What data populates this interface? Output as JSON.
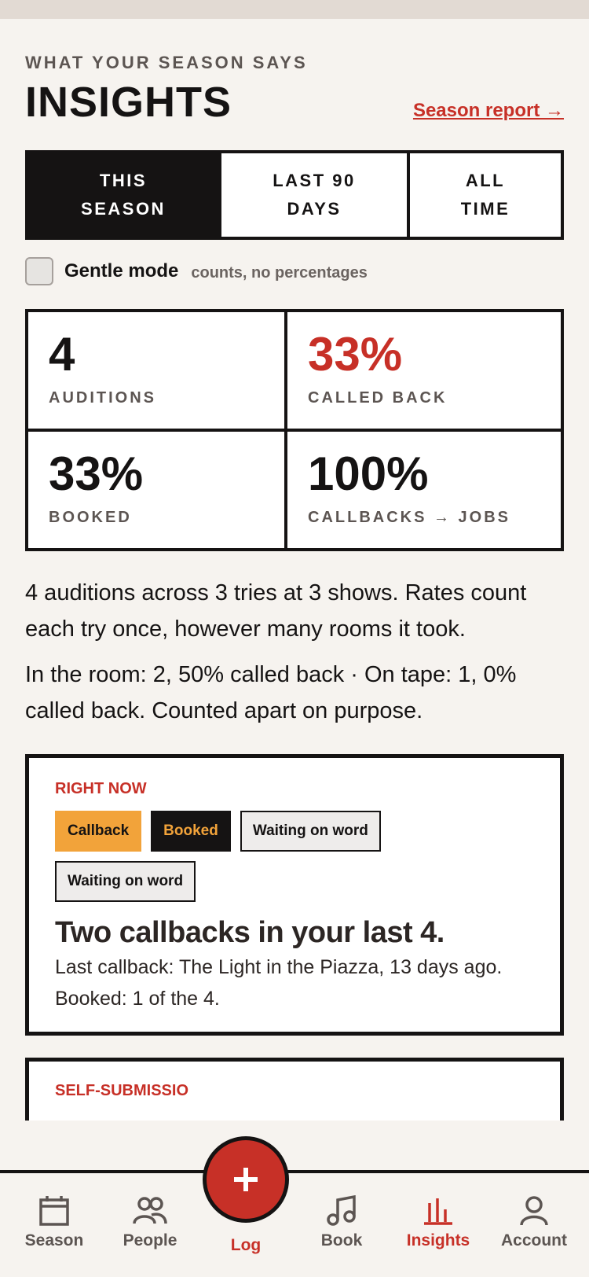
{
  "header": {
    "eyebrow": "WHAT YOUR SEASON SAYS",
    "title": "INSIGHTS",
    "report_link": "Season report →"
  },
  "tabs": [
    {
      "label": "THIS\nSEASON",
      "selected": true
    },
    {
      "label": "LAST 90\nDAYS",
      "selected": false
    },
    {
      "label": "ALL\nTIME",
      "selected": false
    }
  ],
  "gentle_mode": {
    "label": "Gentle mode",
    "hint": "counts, no percentages",
    "checked": false
  },
  "stats": [
    {
      "value": "4",
      "label": "AUDITIONS"
    },
    {
      "value": "33%",
      "label": "CALLED BACK"
    },
    {
      "value": "33%",
      "label": "BOOKED"
    },
    {
      "value": "100%",
      "label": "CALLBACKS → JOBS"
    }
  ],
  "summary": {
    "line1": "4 auditions across 3 tries at 3 shows. Rates count each try once, however many rooms it took.",
    "line2": "In the room: 2, 50% called back · On tape: 1, 0% called back. Counted apart on purpose."
  },
  "right_now": {
    "eyebrow": "RIGHT NOW",
    "chips": [
      "Callback",
      "Booked",
      "Waiting on word",
      "Waiting on word"
    ],
    "headline": "Two callbacks in your last 4.",
    "body": "Last callback: The Light in the Piazza, 13 days ago. Booked: 1 of the 4."
  },
  "next_card": {
    "eyebrow": "SELF-SUBMISSIO"
  },
  "nav": {
    "items": [
      {
        "label": "Season",
        "icon": "calendar-icon"
      },
      {
        "label": "People",
        "icon": "people-icon"
      },
      {
        "label": "Log",
        "icon": "plus-icon"
      },
      {
        "label": "Book",
        "icon": "music-note-icon"
      },
      {
        "label": "Insights",
        "icon": "bar-chart-icon"
      },
      {
        "label": "Account",
        "icon": "user-icon"
      }
    ],
    "active": "Insights"
  },
  "colors": {
    "accent": "#c73027",
    "ink": "#151313",
    "amber": "#f2a33a",
    "background": "#f6f3ef"
  }
}
